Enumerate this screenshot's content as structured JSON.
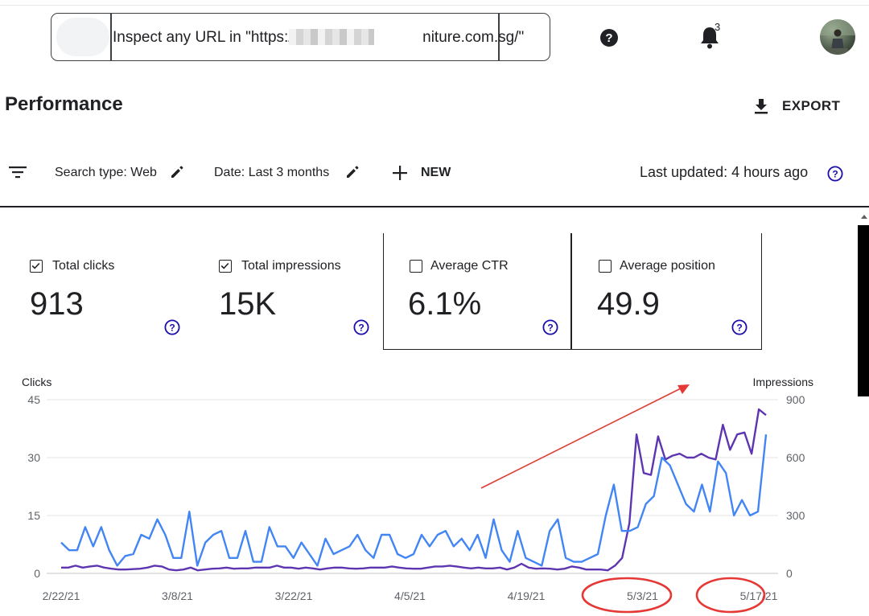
{
  "search": {
    "url_text": "Inspect any URL in \"https://www.                     niture.com.sg/\""
  },
  "header": {
    "notification_count": "3",
    "page_title": "Performance",
    "export_label": "EXPORT"
  },
  "filters": {
    "search_type": "Search type: Web",
    "date": "Date: Last 3 months",
    "new_label": "NEW",
    "last_updated": "Last updated: 4 hours ago"
  },
  "metrics": [
    {
      "label": "Total clicks",
      "value": "913",
      "checked": true
    },
    {
      "label": "Total impressions",
      "value": "15K",
      "checked": true
    },
    {
      "label": "Average CTR",
      "value": "6.1%",
      "checked": false
    },
    {
      "label": "Average position",
      "value": "49.9",
      "checked": false
    }
  ],
  "colors": {
    "clicks": "#5e35b1",
    "impressions": "#4285f4",
    "annotation": "#e53935",
    "help": "#1a0dab"
  },
  "chart_data": {
    "type": "line",
    "ylabel_left": "Clicks",
    "ylabel_right": "Impressions",
    "yticks_left": [
      "45",
      "30",
      "15",
      "0"
    ],
    "yticks_right": [
      "900",
      "600",
      "300",
      "0"
    ],
    "ylim_left": [
      0,
      45
    ],
    "ylim_right": [
      0,
      900
    ],
    "xticks": [
      "2/22/21",
      "3/8/21",
      "3/22/21",
      "4/5/21",
      "4/19/21",
      "5/3/21",
      "5/17/21"
    ],
    "x_start": "2/22/21",
    "x_end": "5/24/21",
    "series": [
      {
        "name": "Clicks",
        "axis": "left",
        "color": "#5e35b1",
        "values": [
          1.5,
          1.5,
          2,
          1.5,
          1.8,
          2,
          1.5,
          1.2,
          1,
          1,
          1.1,
          1.2,
          1.5,
          2,
          1.8,
          1,
          0.8,
          1,
          1.5,
          0.8,
          1,
          1.2,
          1.3,
          1.5,
          1.2,
          1.3,
          1.3,
          1.5,
          1.5,
          1.5,
          2,
          1.5,
          1.5,
          1.2,
          1.5,
          1.3,
          1,
          1.3,
          1.5,
          1.5,
          1.3,
          1.2,
          1.3,
          1.5,
          1.5,
          1.5,
          1.8,
          1.5,
          1.3,
          1.2,
          1.2,
          1.5,
          1.8,
          1.8,
          2,
          1.8,
          1.5,
          1.3,
          1.5,
          1.3,
          1.3,
          1.5,
          1,
          1.5,
          2.5,
          1.5,
          1.2,
          1.3,
          1.2,
          1,
          1.2,
          1.8,
          1.5,
          1,
          1,
          1,
          0.8,
          2,
          4,
          13,
          36,
          26,
          25.5,
          35.5,
          29.5,
          30.5,
          31,
          30,
          30,
          31,
          30,
          29.5,
          38.5,
          32,
          36,
          36.5,
          31,
          42.5,
          41
        ]
      },
      {
        "name": "Impressions",
        "axis": "right",
        "color": "#4285f4",
        "values": [
          160,
          120,
          120,
          240,
          140,
          240,
          120,
          40,
          90,
          100,
          200,
          180,
          280,
          200,
          80,
          80,
          320,
          40,
          160,
          200,
          220,
          80,
          80,
          220,
          60,
          60,
          240,
          140,
          140,
          80,
          160,
          100,
          40,
          180,
          100,
          120,
          140,
          200,
          120,
          80,
          200,
          200,
          100,
          80,
          100,
          200,
          140,
          200,
          220,
          140,
          180,
          120,
          200,
          80,
          280,
          120,
          60,
          220,
          80,
          60,
          40,
          220,
          280,
          80,
          60,
          60,
          80,
          100,
          300,
          460,
          220,
          220,
          240,
          360,
          400,
          600,
          560,
          460,
          360,
          320,
          460,
          320,
          580,
          520,
          300,
          380,
          300,
          320,
          720
        ]
      }
    ],
    "annotations": [
      {
        "type": "arrow",
        "color": "#e53935"
      },
      {
        "type": "ellipse",
        "label": "5/3/21",
        "color": "#e53935"
      },
      {
        "type": "ellipse",
        "label": "5/17/21",
        "color": "#e53935"
      }
    ]
  }
}
